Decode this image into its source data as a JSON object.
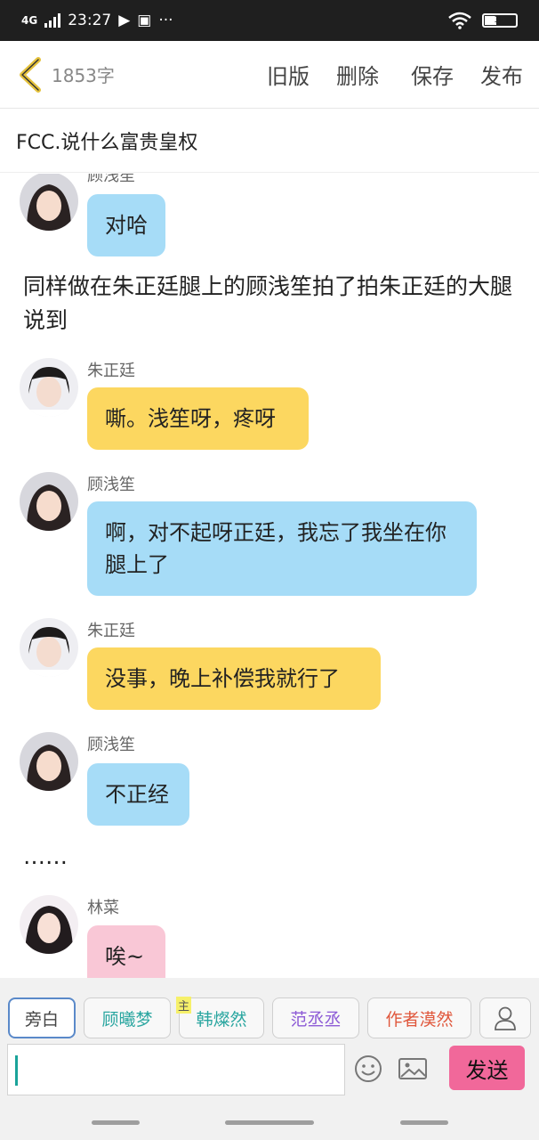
{
  "status": {
    "network": "4G",
    "time": "23:27",
    "dots": "···",
    "battery": "35"
  },
  "header": {
    "word_count": "1853字",
    "actions": [
      "旧版",
      "删除",
      "保存",
      "发布"
    ]
  },
  "title": "FCC.说什么富贵皇权",
  "messages": [
    {
      "kind": "msg",
      "speaker": "顾浅笙",
      "text": "对哈",
      "color": "blue"
    },
    {
      "kind": "narration",
      "text": "同样做在朱正廷腿上的顾浅笙拍了拍朱正廷的大腿说到"
    },
    {
      "kind": "msg",
      "speaker": "朱正廷",
      "text": "嘶。浅笙呀，疼呀",
      "color": "yellow"
    },
    {
      "kind": "msg",
      "speaker": "顾浅笙",
      "text": "啊，对不起呀正廷，我忘了我坐在你腿上了",
      "color": "blue"
    },
    {
      "kind": "msg",
      "speaker": "朱正廷",
      "text": "没事，晚上补偿我就行了",
      "color": "yellow"
    },
    {
      "kind": "msg",
      "speaker": "顾浅笙",
      "text": "不正经",
      "color": "blue"
    },
    {
      "kind": "narration",
      "text": "……"
    },
    {
      "kind": "msg",
      "speaker": "林菜",
      "text": "唉~",
      "color": "pink"
    }
  ],
  "roles": [
    {
      "label": "旁白",
      "color": "#444444",
      "active": true
    },
    {
      "label": "顾曦梦",
      "color": "#2aa6a0"
    },
    {
      "label": "韩燦然",
      "color": "#2aa6a0",
      "badge": "主"
    },
    {
      "label": "范丞丞",
      "color": "#8d5bd6"
    },
    {
      "label": "作者漠然",
      "color": "#e0573c"
    }
  ],
  "composer": {
    "input_value": "",
    "send_label": "发送"
  },
  "icons": [
    "back-chevron-icon",
    "user-icon",
    "emoji-icon",
    "image-icon"
  ],
  "colors": {
    "blue_bubble": "#a6dcf7",
    "yellow_bubble": "#fcd760",
    "pink_bubble": "#f9c7d6",
    "send": "#f1689a",
    "accent_back": "#e5c23c"
  }
}
